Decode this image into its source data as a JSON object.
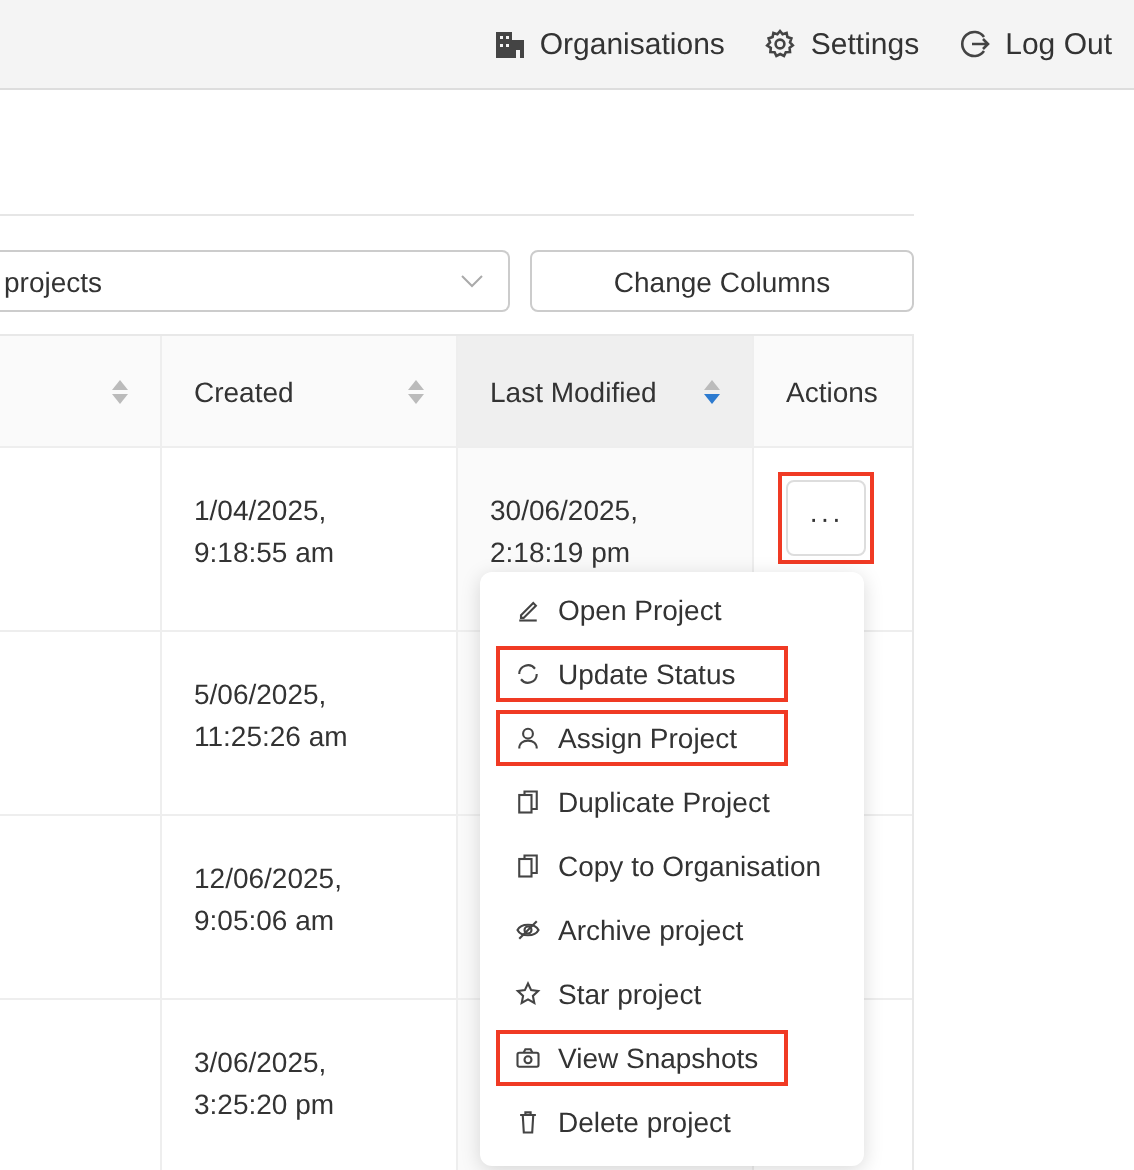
{
  "nav": [
    {
      "kind": "building",
      "label": "Organisations"
    },
    {
      "kind": "gear",
      "label": "Settings"
    },
    {
      "kind": "logout",
      "label": "Log Out"
    }
  ],
  "filter": {
    "value": "projects"
  },
  "change_columns_button": "Change Columns",
  "table": {
    "columns": [
      {
        "sorted": false
      },
      {
        "label": "Created",
        "sorted": false
      },
      {
        "label": "Last Modified",
        "sorted": true
      },
      {
        "label": "Actions"
      }
    ],
    "rows": [
      {
        "created": "1/04/2025,\n9:18:55 am",
        "modified": "30/06/2025,\n2:18:19 pm",
        "actions_highlighted": true
      },
      {
        "created": "5/06/2025,\n11:25:26 am"
      },
      {
        "created": "12/06/2025,\n9:05:06 am"
      },
      {
        "created": "3/06/2025,\n3:25:20 pm"
      }
    ]
  },
  "actions_button": "···",
  "menu": [
    {
      "kind": "pencil",
      "label": "Open Project",
      "highlighted": false
    },
    {
      "kind": "refresh",
      "label": "Update Status",
      "highlighted": true
    },
    {
      "kind": "user",
      "label": "Assign Project",
      "highlighted": true
    },
    {
      "kind": "copy",
      "label": "Duplicate Project",
      "highlighted": false
    },
    {
      "kind": "copy",
      "label": "Copy to Organisation",
      "highlighted": false
    },
    {
      "kind": "eye-off",
      "label": "Archive project",
      "highlighted": false
    },
    {
      "kind": "star",
      "label": "Star project",
      "highlighted": false
    },
    {
      "kind": "camera",
      "label": "View Snapshots",
      "highlighted": true
    },
    {
      "kind": "trash",
      "label": "Delete project",
      "highlighted": false
    }
  ]
}
